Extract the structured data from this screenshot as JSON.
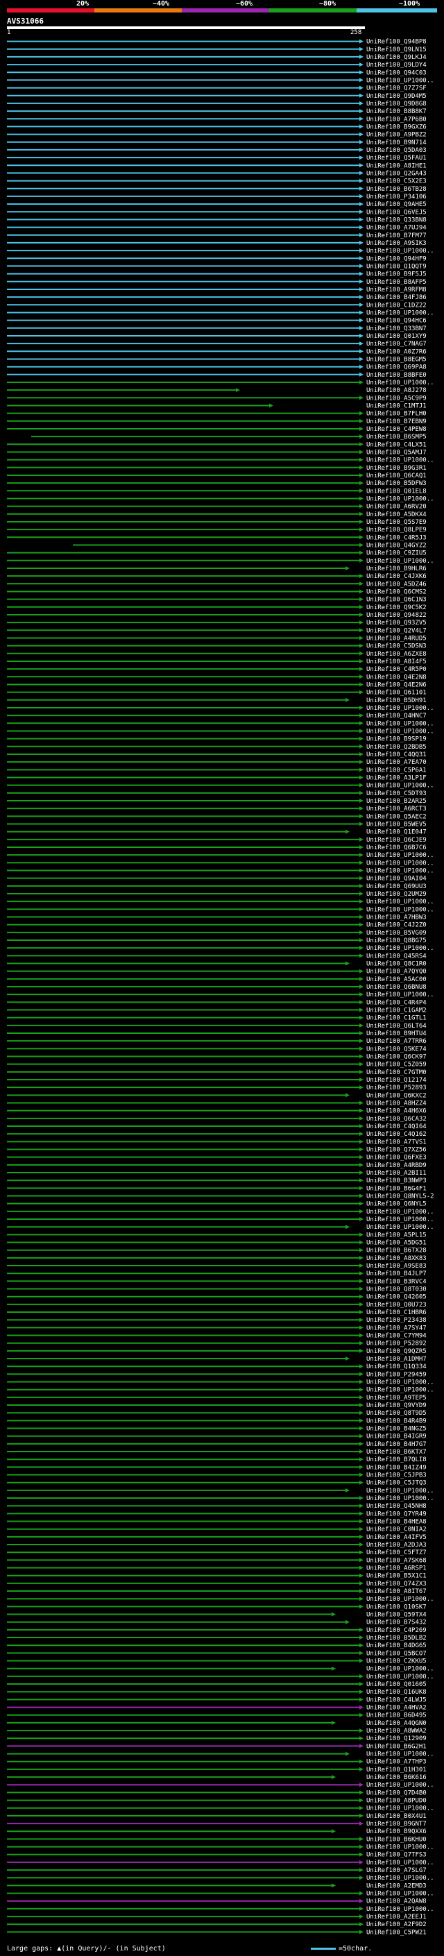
{
  "scale": {
    "labels": [
      "20%",
      "~40%",
      "~60%",
      "~80%",
      "~100%"
    ],
    "colors": [
      "#e8102a",
      "#e87a10",
      "#9b27b0",
      "#1aa01a",
      "#4fc3e8"
    ]
  },
  "query": {
    "name": "AVS31066",
    "start": "1",
    "end": "258"
  },
  "colors": {
    "cyan": "#4fc3e8",
    "green": "#1aa01a",
    "purple": "#9b27b0"
  },
  "hits": [
    "UniRef100_Q94BP8",
    "UniRef100_Q9LN15",
    "UniRef100_Q9LKJ4",
    "UniRef100_Q9LDY4",
    "UniRef100_Q94C03",
    "UniRef100_UP1000..",
    "UniRef100_Q7Z7SF",
    "UniRef100_Q9D4M5",
    "UniRef100_Q9D8G8",
    "UniRef100_B8B8K7",
    "UniRef100_A7P6B0",
    "UniRef100_B9GXZ6",
    "UniRef100_A9PBZ2",
    "UniRef100_B9N714",
    "UniRef100_Q5DA03",
    "UniRef100_Q5FAU1",
    "UniRef100_A8IHE1",
    "UniRef100_Q2GA43",
    "UniRef100_C5X2E3",
    "UniRef100_B6TB28",
    "UniRef100_P34106",
    "UniRef100_Q9AHE5",
    "UniRef100_Q6VEJ5",
    "UniRef100_Q33BN8",
    "UniRef100_A7UJ94",
    "UniRef100_B7FM77",
    "UniRef100_A9SIK3",
    "UniRef100_UP1000..",
    "UniRef100_Q94HF9",
    "UniRef100_Q1QQT9",
    "UniRef100_B9F5J5",
    "UniRef100_B8AFP5",
    "UniRef100_A9RFM8",
    "UniRef100_B4FJ86",
    "UniRef100_C1DZ22",
    "UniRef100_UP1000..",
    "UniRef100_Q94HC6",
    "UniRef100_Q33BN7",
    "UniRef100_Q01XY9",
    "UniRef100_C7NAG7",
    "UniRef100_A0Z7R6",
    "UniRef100_B8EGM5",
    "UniRef100_Q69PA8",
    "UniRef100_B8BFE0",
    "UniRef100_UP1000..",
    "UniRef100_A8J278",
    "UniRef100_A5C9P9",
    "UniRef100_C1MTJ1",
    "UniRef100_B7FLH0",
    "UniRef100_B7EBN9",
    "UniRef100_C4PEW8",
    "UniRef100_B6SMP5",
    "UniRef100_C4LX51",
    "UniRef100_Q5AMJ7",
    "UniRef100_UP1000..",
    "UniRef100_B9G3R1",
    "UniRef100_Q6CAQ1",
    "UniRef100_B5DFW3",
    "UniRef100_Q01EL8",
    "UniRef100_UP1000..",
    "UniRef100_A6RV20",
    "UniRef100_A5DKX4",
    "UniRef100_Q5S7E9",
    "UniRef100_Q8LPE9",
    "UniRef100_C4R5J3",
    "UniRef100_Q4GYZ2",
    "UniRef100_C9ZIU5",
    "UniRef100_UP1000..",
    "UniRef100_B9HLR6",
    "UniRef100_C4JXK6",
    "UniRef100_A5DZ46",
    "UniRef100_Q6CMS2",
    "UniRef100_Q6C1N3",
    "UniRef100_Q9C5K2",
    "UniRef100_Q94822",
    "UniRef100_Q93ZV5",
    "UniRef100_Q2V4L7",
    "UniRef100_A4RUD5",
    "UniRef100_C5DSN3",
    "UniRef100_A6ZXE8",
    "UniRef100_A8I4F5",
    "UniRef100_C4R5P0",
    "UniRef100_Q4E2N8",
    "UniRef100_Q4E2N6",
    "UniRef100_Q61101",
    "UniRef100_B5DH91",
    "UniRef100_UP1000..",
    "UniRef100_Q4HNC7",
    "UniRef100_UP1000..",
    "UniRef100_UP1000..",
    "UniRef100_B9SP19",
    "UniRef100_Q2BDB5",
    "UniRef100_C4QQ31",
    "UniRef100_A7EA70",
    "UniRef100_C5P6A1",
    "UniRef100_A3LP1F",
    "UniRef100_UP1000..",
    "UniRef100_C5DT93",
    "UniRef100_B2AR25",
    "UniRef100_A6RCT3",
    "UniRef100_Q5AEC2",
    "UniRef100_B5WEV5",
    "UniRef100_Q1E047",
    "UniRef100_Q6CJE9",
    "UniRef100_Q6B7C6",
    "UniRef100_UP1000..",
    "UniRef100_UP1000..",
    "UniRef100_UP1000..",
    "UniRef100_Q9AI04",
    "UniRef100_Q69UU3",
    "UniRef100_Q2UM29",
    "UniRef100_UP1000..",
    "UniRef100_UP1000..",
    "UniRef100_A7HBW3",
    "UniRef100_C4J2Z0",
    "UniRef100_B5VG09",
    "UniRef100_Q8BG75",
    "UniRef100_UP1000..",
    "UniRef100_Q45RS4",
    "UniRef100_Q8C1R0",
    "UniRef100_A7QYQ0",
    "UniRef100_A5AC00",
    "UniRef100_Q6BNU8",
    "UniRef100_UP1000..",
    "UniRef100_C4R4P4",
    "UniRef100_C1GAM2",
    "UniRef100_C1GTL1",
    "UniRef100_Q6LT64",
    "UniRef100_B9HTU4",
    "UniRef100_A7TRR6",
    "UniRef100_Q5KE74",
    "UniRef100_Q6CK97",
    "UniRef100_C5Z059",
    "UniRef100_C7GTM0",
    "UniRef100_Q12174",
    "UniRef100_P52893",
    "UniRef100_Q6KXC2",
    "UniRef100_A8HZZ4",
    "UniRef100_A4H6X6",
    "UniRef100_Q6CA32",
    "UniRef100_C4QI64",
    "UniRef100_C4Q162",
    "UniRef100_A7TVS1",
    "UniRef100_Q7XZ56",
    "UniRef100_Q6FXE3",
    "UniRef100_A4RBD9",
    "UniRef100_A2BI11",
    "UniRef100_B3NWP3",
    "UniRef100_B6G4F1",
    "UniRef100_Q8NYL5-2",
    "UniRef100_Q6NYL5",
    "UniRef100_UP1000..",
    "UniRef100_UP1000..",
    "UniRef100_UP1000..",
    "UniRef100_A5PL15",
    "UniRef100_A5DG51",
    "UniRef100_B6TX28",
    "UniRef100_A8XK83",
    "UniRef100_A9SE83",
    "UniRef100_B4JLP7",
    "UniRef100_B3RVC4",
    "UniRef100_Q8T030",
    "UniRef100_Q42605",
    "UniRef100_Q0U723",
    "UniRef100_C1HBR6",
    "UniRef100_P23438",
    "UniRef100_A7SY47",
    "UniRef100_C7YM94",
    "UniRef100_P52892",
    "UniRef100_Q9QZR5",
    "UniRef100_A1DMH7",
    "UniRef100_Q1Q334",
    "UniRef100_P29459",
    "UniRef100_UP1000..",
    "UniRef100_UP1000..",
    "UniRef100_A9TEP5",
    "UniRef100_Q9VYD9",
    "UniRef100_Q8T9D5",
    "UniRef100_B4R4B9",
    "UniRef100_B4NGZ5",
    "UniRef100_B4IGR9",
    "UniRef100_B4H7G7",
    "UniRef100_B6KTX7",
    "UniRef100_B7QLI8",
    "UniRef100_B4IZ49",
    "UniRef100_C5JPB3",
    "UniRef100_C5JTQ3",
    "UniRef100_UP1000..",
    "UniRef100_UP1000..",
    "UniRef100_Q45NH8",
    "UniRef100_Q7YR49",
    "UniRef100_B4HEA8",
    "UniRef100_C0NIA2",
    "UniRef100_A4IFV5",
    "UniRef100_A2DJA3",
    "UniRef100_C5FTZ7",
    "UniRef100_A7SK68",
    "UniRef100_A6RSP1",
    "UniRef100_B5X1C1",
    "UniRef100_Q74ZX3",
    "UniRef100_A8IT67",
    "UniRef100_UP1000..",
    "UniRef100_Q10SK7",
    "UniRef100_Q59TX4",
    "UniRef100_B7S432",
    "UniRef100_C4P269",
    "UniRef100_B5DLB2",
    "UniRef100_B4DG65",
    "UniRef100_Q5BCO7",
    "UniRef100_C2KKU5",
    "UniRef100_UP1000..",
    "UniRef100_UP1000..",
    "UniRef100_Q01605",
    "UniRef100_Q16UK8",
    "UniRef100_C4LWJ5",
    "UniRef100_A4HVA2",
    "UniRef100_B6D495",
    "UniRef100_A4QGN0",
    "UniRef100_A8WWA2",
    "UniRef100_Q12909",
    "UniRef100_B6G2H1",
    "UniRef100_UP1000..",
    "UniRef100_A7THP3",
    "UniRef100_Q1H301",
    "UniRef100_B6K616",
    "UniRef100_UP1000..",
    "UniRef100_Q7D4B0",
    "UniRef100_A8PUD0",
    "UniRef100_UP1000..",
    "UniRef100_B0X4U1",
    "UniRef100_B9GNT7",
    "UniRef100_B9QXX6",
    "UniRef100_B6KHU0",
    "UniRef100_UP1000..",
    "UniRef100_Q7TFS3",
    "UniRef100_UP1000..",
    "UniRef100_A7SLG7",
    "UniRef100_UP1000..",
    "UniRef100_A2EMD3",
    "UniRef100_UP1000..",
    "UniRef100_A2QAW8",
    "UniRef100_UP1000..",
    "UniRef100_A2EEJ1",
    "UniRef100_A2F9D2",
    "UniRef100_C5PW21"
  ],
  "footer": {
    "gaps_label": "Large gaps: ▲(in Query)/- (in Subject)",
    "key_label": "=50char."
  }
}
